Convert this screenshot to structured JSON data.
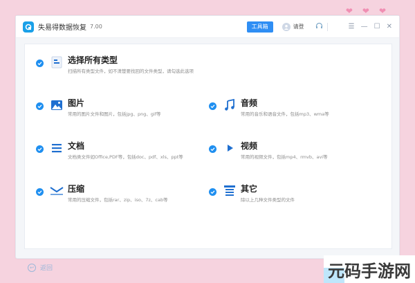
{
  "app": {
    "title": "失易得数据恢复",
    "version": "7.00",
    "toolbox_label": "工具箱",
    "login_label": "请登"
  },
  "options": [
    {
      "title": "选择所有类型",
      "desc": "扫描所有类型文件，如不清楚要找回的文件类型，请勾选此选项",
      "icon": "all-types-icon"
    },
    {
      "title": "图片",
      "desc": "常用的图片文件和图片，包括jpg、png、gif等",
      "icon": "image-icon"
    },
    {
      "title": "音频",
      "desc": "常用的音乐和语音文件，包括mp3、wma等",
      "icon": "music-icon"
    },
    {
      "title": "文档",
      "desc": "文档类文件如Office,PDF等，包括doc、pdf、xls、ppt等",
      "icon": "document-icon"
    },
    {
      "title": "视频",
      "desc": "常用的视频文件，包括mp4、rmvb、avi等",
      "icon": "video-icon"
    },
    {
      "title": "压缩",
      "desc": "常用的压缩文件，包括rar、zip、iso、7z、cab等",
      "icon": "archive-icon"
    },
    {
      "title": "其它",
      "desc": "除以上几种文件类型的文件",
      "icon": "other-icon"
    }
  ],
  "footer": {
    "back_label": "返回"
  },
  "watermark": {
    "text": "元码手游网"
  },
  "colors": {
    "accent": "#1f8ff0",
    "background": "#f6d3df"
  }
}
